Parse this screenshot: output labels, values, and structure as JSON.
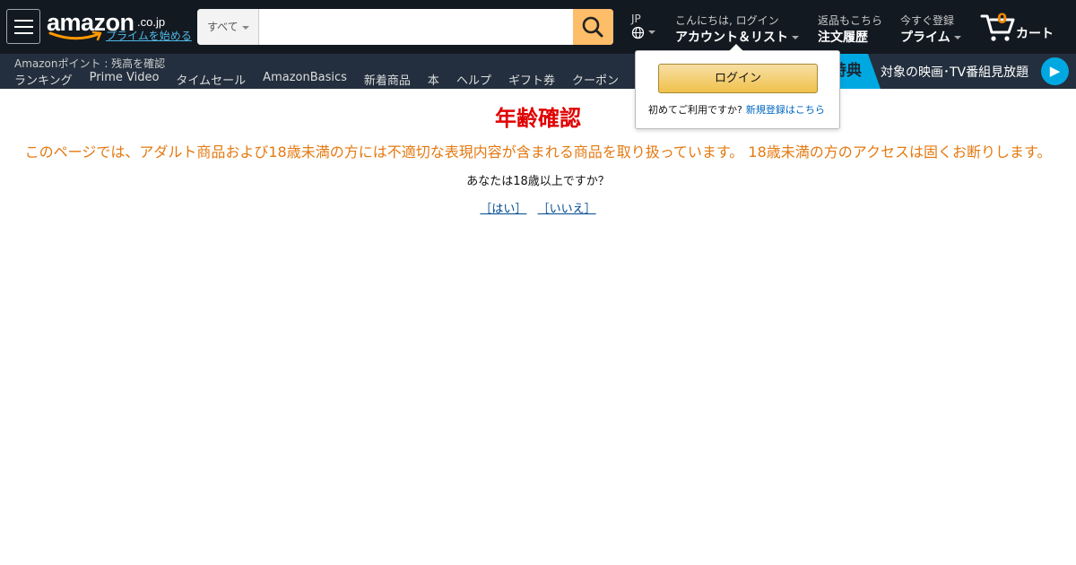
{
  "header": {
    "logo_text": "amazon",
    "logo_tld": ".co.jp",
    "prime_link": "プライムを始める",
    "search": {
      "category": "すべて",
      "placeholder": "",
      "value": ""
    },
    "language": {
      "line1": "JP",
      "icon": "globe-icon"
    },
    "account": {
      "line1": "こんにちは, ログイン",
      "line2": "アカウント＆リスト"
    },
    "orders": {
      "line1": "返品もこちら",
      "line2": "注文履歴"
    },
    "prime": {
      "line1": "今すぐ登録",
      "line2": "プライム"
    },
    "cart": {
      "count": "0",
      "label": "カート"
    }
  },
  "subnav": {
    "points": "Amazonポイント : 残高を確認",
    "links": [
      "ランキング",
      "Prime Video",
      "タイムセール",
      "AmazonBasics",
      "新着商品",
      "本",
      "ヘルプ",
      "ギフト券",
      "クーポン"
    ],
    "promo": {
      "badge": "特典",
      "text": "対象の映画･TV番組見放題",
      "play_icon": "play-icon"
    }
  },
  "flyout": {
    "login_label": "ログイン",
    "note": "初めてご利用ですか?",
    "register_link": "新規登録はこちら"
  },
  "main": {
    "title": "年齢確認",
    "warning": "このページでは、アダルト商品および18歳未満の方には不適切な表現内容が含まれる商品を取り扱っています。 18歳未満の方のアクセスは固くお断りします。",
    "question": "あなたは18歳以上ですか？",
    "yes_label": "［はい］",
    "no_label": "［いいえ］"
  },
  "colors": {
    "topbar": "#131921",
    "subbar": "#232f3e",
    "search_button": "#febd69",
    "title_red": "#e00000",
    "warning_orange": "#e47911",
    "link_blue": "#004b91",
    "prime_blue": "#00a8e1"
  }
}
